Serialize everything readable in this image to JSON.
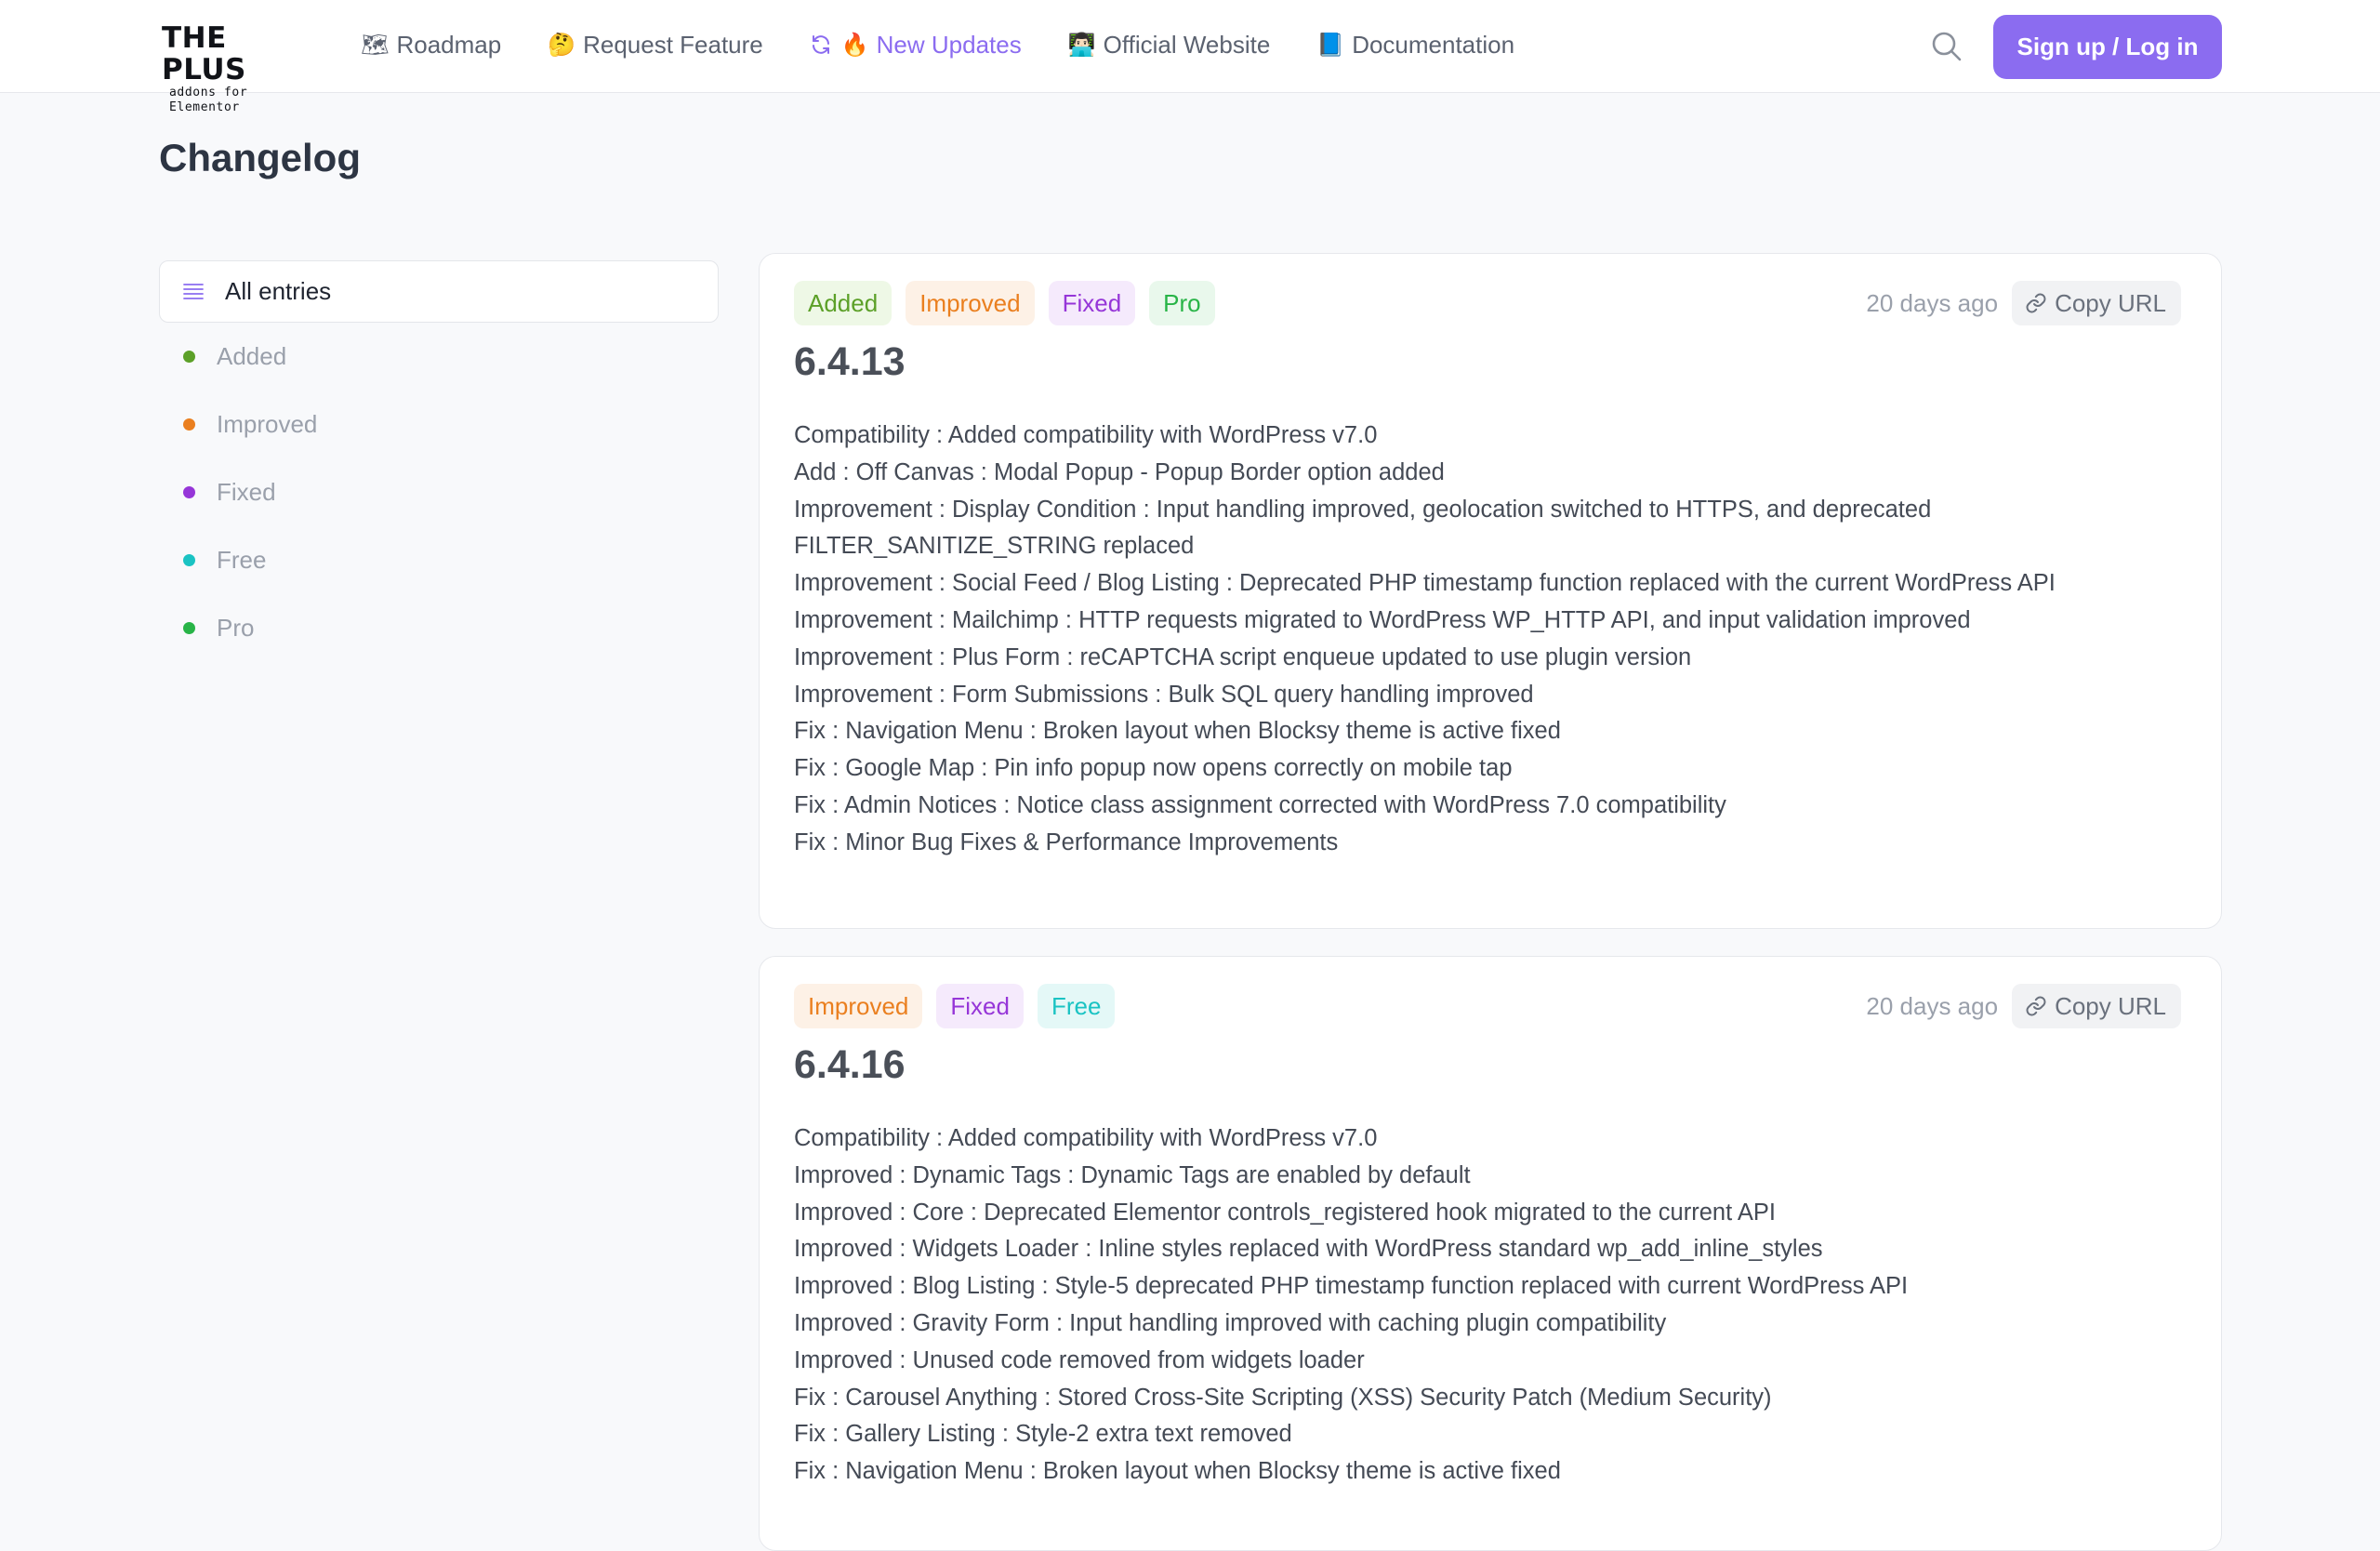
{
  "header": {
    "logo_title": "THE PLUS",
    "logo_subtitle": "addons for Elementor",
    "nav": [
      {
        "label": "Roadmap",
        "icon": "🗺"
      },
      {
        "label": "Request Feature",
        "icon": "🤔"
      },
      {
        "label": "New Updates",
        "icon": "🔥",
        "active": true
      },
      {
        "label": "Official Website",
        "icon": "👨🏻‍💻"
      },
      {
        "label": "Documentation",
        "icon": "📘"
      }
    ],
    "auth_label": "Sign up / Log in"
  },
  "page_title": "Changelog",
  "sidebar": {
    "all_label": "All entries",
    "items": [
      {
        "label": "Added",
        "color": "#5ca028"
      },
      {
        "label": "Improved",
        "color": "#ea7f1f"
      },
      {
        "label": "Fixed",
        "color": "#9636d8"
      },
      {
        "label": "Free",
        "color": "#1ac3c3"
      },
      {
        "label": "Pro",
        "color": "#28b447"
      }
    ]
  },
  "colors": {
    "accent": "#8b6cf0"
  },
  "entries": [
    {
      "tags": [
        "Added",
        "Improved",
        "Fixed",
        "Pro"
      ],
      "ago": "20 days ago",
      "copy_label": "Copy URL",
      "version": "6.4.13",
      "lines": [
        "Compatibility : Added compatibility with WordPress v7.0",
        "Add : Off Canvas : Modal Popup - Popup Border option added",
        "Improvement : Display Condition : Input handling improved, geolocation switched to HTTPS, and deprecated",
        "FILTER_SANITIZE_STRING replaced",
        "Improvement : Social Feed / Blog Listing : Deprecated PHP timestamp function replaced with the current WordPress API",
        "Improvement : Mailchimp : HTTP requests migrated to WordPress WP_HTTP API, and input validation improved",
        "Improvement : Plus Form : reCAPTCHA script enqueue updated to use plugin version",
        "Improvement : Form Submissions : Bulk SQL query handling improved",
        "Fix : Navigation Menu : Broken layout when Blocksy theme is active fixed",
        "Fix : Google Map : Pin info popup now opens correctly on mobile tap",
        "Fix : Admin Notices : Notice class assignment corrected with WordPress 7.0 compatibility",
        "Fix : Minor Bug Fixes & Performance Improvements"
      ]
    },
    {
      "tags": [
        "Improved",
        "Fixed",
        "Free"
      ],
      "ago": "20 days ago",
      "copy_label": "Copy URL",
      "version": "6.4.16",
      "lines": [
        "Compatibility : Added compatibility with WordPress v7.0",
        "Improved : Dynamic Tags : Dynamic Tags are enabled by default",
        "Improved : Core : Deprecated Elementor controls_registered hook migrated to the current API",
        "Improved : Widgets Loader : Inline styles replaced with WordPress standard wp_add_inline_styles",
        "Improved : Blog Listing : Style-5 deprecated PHP timestamp function replaced with current WordPress API",
        "Improved : Gravity Form : Input handling improved with caching plugin compatibility",
        "Improved : Unused code removed from widgets loader",
        "Fix : Carousel Anything : Stored Cross-Site Scripting (XSS) Security Patch (Medium Security)",
        "Fix : Gallery Listing : Style-2 extra text removed",
        "Fix : Navigation Menu : Broken layout when Blocksy theme is active fixed"
      ]
    }
  ]
}
